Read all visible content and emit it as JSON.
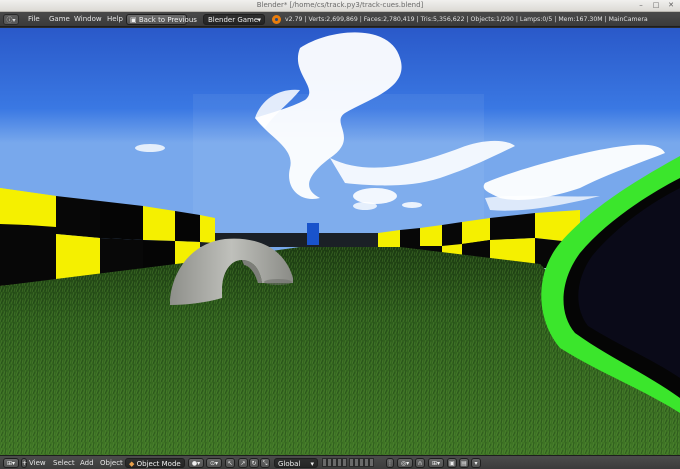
{
  "window": {
    "title": "Blender* [/home/cs/track.py3/track-cues.blend]",
    "buttons": {
      "minimize": "–",
      "maximize": "□",
      "close": "✕"
    }
  },
  "info_header": {
    "editor_icon": "info-editor-icon",
    "menus": [
      "File",
      "Game",
      "Window",
      "Help"
    ],
    "back_button": "Back to Previous",
    "engine": "Blender Game",
    "stats": "v2.79 | Verts:2,699,869 | Faces:2,780,419 | Tris:5,356,622 | Objects:1/290 | Lamps:0/5 | Mem:167.30M | MainCamera"
  },
  "view_header": {
    "editor_icon": "view3d-editor-icon",
    "menus": [
      "View",
      "Select",
      "Add",
      "Object"
    ],
    "mode": "Object Mode",
    "orientation": "Global"
  },
  "scene": {
    "sky_top": "#2f5fd0",
    "grass": "#2c5a1a",
    "checker_yellow": "#f5f000",
    "checker_black": "#050505",
    "wall_green": "#3be62c",
    "arch_grey": "#a7a8a3",
    "block_blue": "#1e5fe0"
  }
}
